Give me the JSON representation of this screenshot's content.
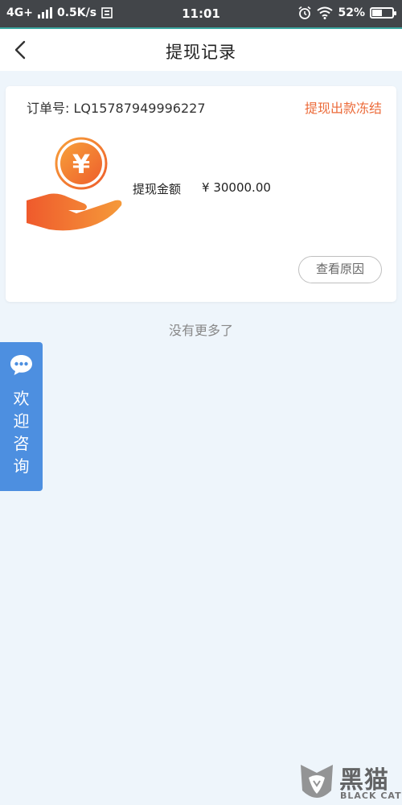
{
  "status_bar": {
    "network": "4G+",
    "speed": "0.5K/s",
    "time": "11:01",
    "battery": "52%",
    "battery_level": 0.52
  },
  "nav": {
    "title": "提现记录"
  },
  "record": {
    "order_label": "订单号:",
    "order_number": "LQ15787949996227",
    "status": "提现出款冻结",
    "amount_label": "提现金额",
    "amount_value": "¥ 30000.00",
    "reason_button": "查看原因",
    "icon_symbol": "¥"
  },
  "footer_note": "没有更多了",
  "consult": {
    "label": "欢迎咨询"
  },
  "watermark": {
    "cn": "黑猫",
    "en": "BLACK CAT"
  },
  "colors": {
    "accent_orange": "#ec6b3a",
    "consult_blue": "#4d8fe0",
    "page_bg": "#eef5fb"
  }
}
